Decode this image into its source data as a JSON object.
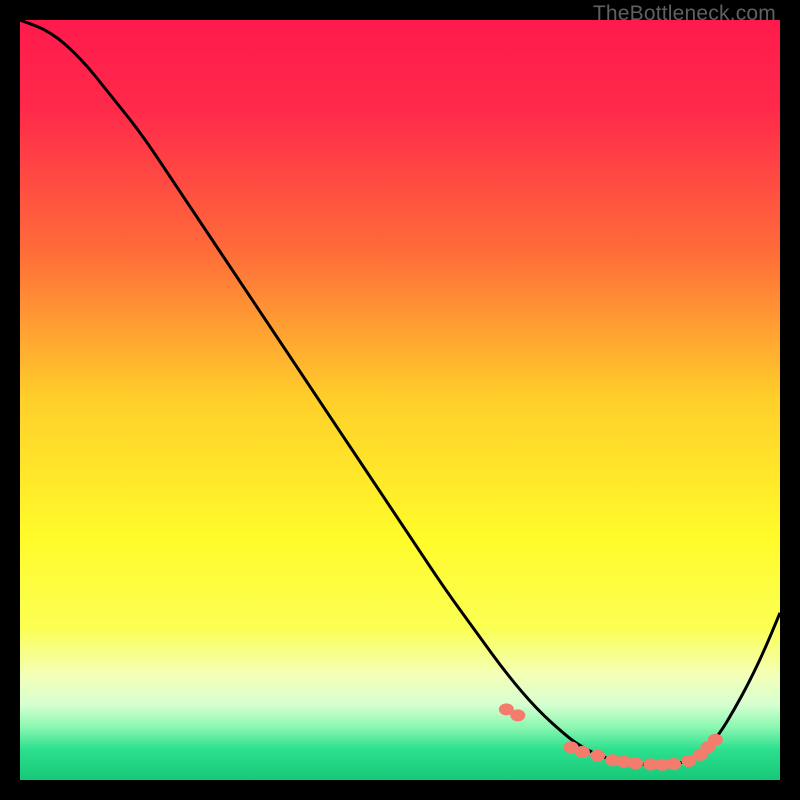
{
  "watermark": "TheBottleneck.com",
  "chart_data": {
    "type": "line",
    "title": "",
    "xlabel": "",
    "ylabel": "",
    "xlim": [
      0,
      100
    ],
    "ylim": [
      0,
      100
    ],
    "gradient": {
      "stops": [
        {
          "offset": 0.0,
          "color": "#ff1a4c"
        },
        {
          "offset": 0.12,
          "color": "#ff2a4a"
        },
        {
          "offset": 0.3,
          "color": "#ff6a3a"
        },
        {
          "offset": 0.5,
          "color": "#ffcf2a"
        },
        {
          "offset": 0.68,
          "color": "#fffb2a"
        },
        {
          "offset": 0.8,
          "color": "#fbff53"
        },
        {
          "offset": 0.86,
          "color": "#f4ffb6"
        },
        {
          "offset": 0.9,
          "color": "#d8ffd0"
        },
        {
          "offset": 0.93,
          "color": "#8cf7b2"
        },
        {
          "offset": 0.96,
          "color": "#2be08e"
        },
        {
          "offset": 1.0,
          "color": "#17c879"
        }
      ]
    },
    "curve": {
      "x": [
        0,
        4,
        8,
        12,
        16,
        20,
        24,
        28,
        32,
        36,
        40,
        44,
        48,
        52,
        56,
        60,
        64,
        68,
        72,
        74,
        76,
        78,
        80,
        82,
        84,
        86,
        88,
        90,
        92,
        94,
        96,
        98,
        100
      ],
      "y": [
        100,
        98.5,
        95,
        90,
        85,
        79,
        73,
        67,
        61,
        55,
        49,
        43,
        37,
        31,
        25,
        19.5,
        14,
        9.3,
        5.7,
        4.3,
        3.3,
        2.6,
        2.2,
        2.05,
        2.0,
        2.1,
        2.5,
        3.7,
        6.0,
        9.3,
        13.0,
        17.2,
        22
      ]
    },
    "markers": {
      "x": [
        64,
        65.5,
        72.5,
        74,
        76,
        78,
        79.5,
        81,
        83,
        84.5,
        86,
        88,
        89.5,
        90.5,
        91.5
      ],
      "y": [
        9.3,
        8.5,
        4.3,
        3.7,
        3.2,
        2.6,
        2.4,
        2.2,
        2.05,
        2.0,
        2.1,
        2.5,
        3.3,
        4.3,
        5.3
      ]
    }
  }
}
